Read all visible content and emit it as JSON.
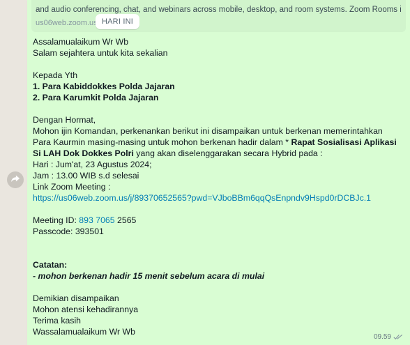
{
  "link_preview": {
    "description": "and audio conferencing, chat, and webinars across mobile, desktop, and room systems. Zoom Rooms is the",
    "domain": "us06web.zoom.us"
  },
  "day_chip": "HARI INI",
  "message": {
    "greeting_1": "Assalamualaikum Wr Wb",
    "greeting_2": "Salam sejahtera untuk kita sekalian",
    "to_heading": "Kepada Yth",
    "to_1": "1. Para Kabiddokkes Polda Jajaran",
    "to_2": "2. Para Karumkit Polda Jajaran",
    "respect": "Dengan Hormat,",
    "body_1": "Mohon ijin Komandan, perkenankan berikut ini disampaikan  untuk berkenan memerintahkan",
    "body_2a": "Para Kaurmin masing-masing untuk mohon berkenan hadir dalam  * ",
    "body_2b": "Rapat  Sosialisasi Aplikasi",
    "body_3a": "Si LAH Dok Dokkes Polri",
    "body_3b": " yang akan diselenggarakan secara Hybrid pada :",
    "day": "Hari : Jum'at, 23 Agustus 2024;",
    "time": "Jam : 13.00 WIB s.d selesai",
    "zoom_label": "Link Zoom Meeting :",
    "zoom_link": "https://us06web.zoom.us/j/89370652565?pwd=VJboBBm6qqQsEnpndv9Hspd0rDCBJc.1",
    "meeting_id_label": "Meeting ID: ",
    "meeting_id_linked": "893 7065",
    "meeting_id_rest": " 2565",
    "passcode": "Passcode: 393501",
    "note_heading": "Catatan:",
    "note_text": "- mohon berkenan hadir 15 menit sebelum acara di mulai",
    "closing_1": "Demikian disampaikan",
    "closing_2": "Mohon atensi kehadirannya",
    "closing_3": "Terima kasih",
    "closing_4": "Wassalamualaikum Wr Wb"
  },
  "timestamp": "09.59",
  "icons": {
    "forward": "forward-icon",
    "read_receipt": "double-check-icon"
  },
  "colors": {
    "bubble": "#d9fdd3",
    "link": "#027eb5"
  }
}
